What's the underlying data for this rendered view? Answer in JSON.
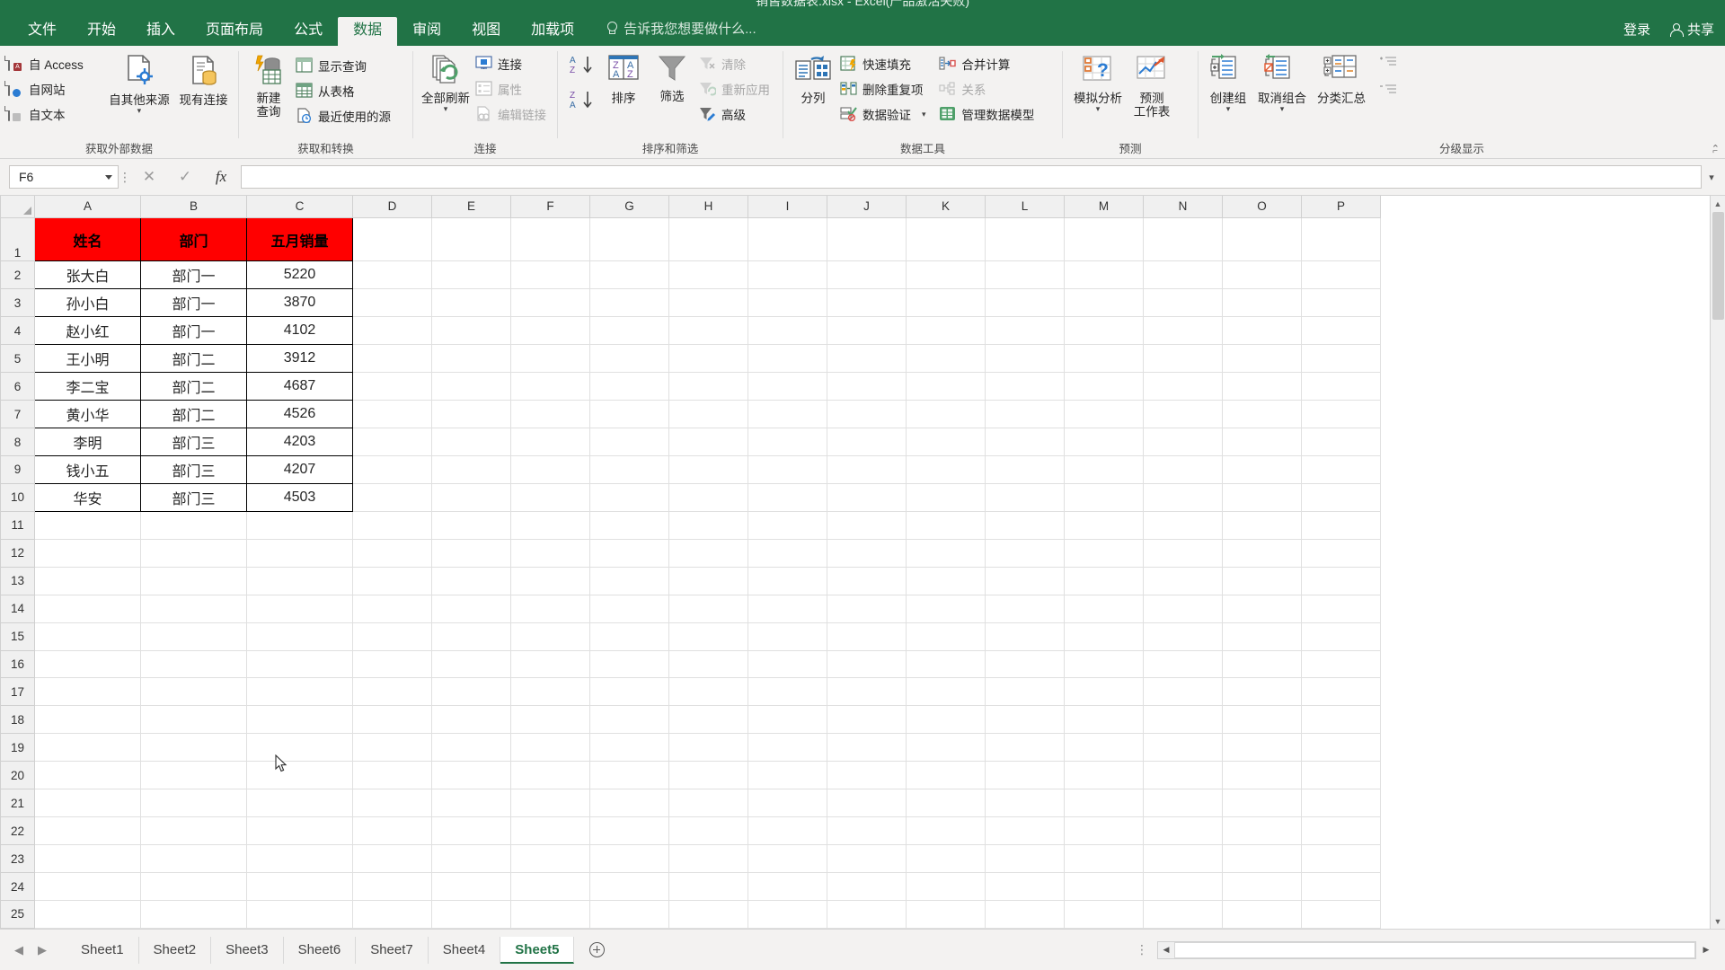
{
  "window": {
    "title": "销售数据表.xlsx - Excel(产品激活失败)"
  },
  "ribbon_tabs": [
    {
      "label": "文件",
      "active": false
    },
    {
      "label": "开始",
      "active": false
    },
    {
      "label": "插入",
      "active": false
    },
    {
      "label": "页面布局",
      "active": false
    },
    {
      "label": "公式",
      "active": false
    },
    {
      "label": "数据",
      "active": true
    },
    {
      "label": "审阅",
      "active": false
    },
    {
      "label": "视图",
      "active": false
    },
    {
      "label": "加载项",
      "active": false
    }
  ],
  "tellme": {
    "placeholder": "告诉我您想要做什么...",
    "icon": "lightbulb-icon"
  },
  "titlebar_right": {
    "signin": "登录",
    "share": "共享",
    "share_icon": "person-icon"
  },
  "ribbon_groups": [
    {
      "name": "获取外部数据",
      "label": "获取外部数据",
      "small_items": [
        "自 Access",
        "自网站",
        "自文本"
      ],
      "big_items": [
        {
          "label_line1": "自其他来源",
          "label_line2": "",
          "has_caret": true,
          "icon": "other-sources-icon"
        },
        {
          "label_line1": "现有连接",
          "label_line2": "",
          "has_caret": false,
          "icon": "existing-connections-icon"
        }
      ]
    },
    {
      "name": "获取和转换",
      "label": "获取和转换",
      "big_items": [
        {
          "label_line1": "新建",
          "label_line2": "查询",
          "has_caret": true,
          "icon": "new-query-icon"
        }
      ],
      "small_items": [
        "显示查询",
        "从表格",
        "最近使用的源"
      ]
    },
    {
      "name": "连接",
      "label": "连接",
      "big_items": [
        {
          "label_line1": "全部刷新",
          "label_line2": "",
          "has_caret": true,
          "icon": "refresh-all-icon"
        }
      ],
      "small_items": [
        {
          "label": "连接",
          "dim": false
        },
        {
          "label": "属性",
          "dim": true
        },
        {
          "label": "编辑链接",
          "dim": true
        }
      ]
    },
    {
      "name": "排序和筛选",
      "label": "排序和筛选",
      "sort_asc": "A→Z",
      "sort_desc": "Z→A",
      "big_items": [
        {
          "label_line1": "排序",
          "label_line2": "",
          "has_caret": false,
          "icon": "sort-icon"
        },
        {
          "label_line1": "筛选",
          "label_line2": "",
          "has_caret": false,
          "icon": "filter-icon"
        }
      ],
      "small_items": [
        {
          "label": "清除",
          "dim": true
        },
        {
          "label": "重新应用",
          "dim": true
        },
        {
          "label": "高级",
          "dim": false
        }
      ]
    },
    {
      "name": "数据工具",
      "label": "数据工具",
      "big_items": [
        {
          "label_line1": "分列",
          "label_line2": "",
          "has_caret": false,
          "icon": "text-to-columns-icon"
        }
      ],
      "small_items_col1": [
        {
          "label": "快速填充",
          "dim": false
        },
        {
          "label": "删除重复项",
          "dim": false
        },
        {
          "label": "数据验证",
          "dim": false,
          "has_caret": true
        }
      ],
      "small_items_col2": [
        {
          "label": "合并计算",
          "dim": false
        },
        {
          "label": "关系",
          "dim": true
        },
        {
          "label": "管理数据模型",
          "dim": false
        }
      ]
    },
    {
      "name": "预测",
      "label": "预测",
      "big_items": [
        {
          "label_line1": "模拟分析",
          "label_line2": "",
          "has_caret": true,
          "icon": "what-if-analysis-icon"
        },
        {
          "label_line1": "预测",
          "label_line2": "工作表",
          "has_caret": false,
          "icon": "forecast-sheet-icon"
        }
      ]
    },
    {
      "name": "分级显示",
      "label": "分级显示",
      "big_items": [
        {
          "label_line1": "创建组",
          "label_line2": "",
          "has_caret": true,
          "icon": "group-icon"
        },
        {
          "label_line1": "取消组合",
          "label_line2": "",
          "has_caret": true,
          "icon": "ungroup-icon"
        },
        {
          "label_line1": "分类汇总",
          "label_line2": "",
          "has_caret": false,
          "icon": "subtotal-icon"
        }
      ],
      "extra_icons": [
        "show-detail-icon",
        "hide-detail-icon"
      ],
      "dialog_launcher": "dialog-launcher-icon"
    }
  ],
  "formula_bar": {
    "name_box_value": "F6",
    "cancel_icon": "cancel-icon",
    "confirm_icon": "confirm-icon",
    "function_icon": "fx-icon",
    "formula_value": "",
    "expand_icon": "chevron-down-icon"
  },
  "grid": {
    "columns": [
      "A",
      "B",
      "C",
      "D",
      "E",
      "F",
      "G",
      "H",
      "I",
      "J",
      "K",
      "L",
      "M",
      "N",
      "O",
      "P"
    ],
    "row_numbers": [
      1,
      2,
      3,
      4,
      5,
      6,
      7,
      8,
      9,
      10,
      11,
      12,
      13,
      14,
      15,
      16,
      17,
      18,
      19,
      20,
      21,
      22,
      23,
      24,
      25
    ],
    "header_row": [
      "姓名",
      "部门",
      "五月销量"
    ],
    "header_fill": "#FF0000",
    "data_rows": [
      [
        "张大白",
        "部门一",
        "5220"
      ],
      [
        "孙小白",
        "部门一",
        "3870"
      ],
      [
        "赵小红",
        "部门一",
        "4102"
      ],
      [
        "王小明",
        "部门二",
        "3912"
      ],
      [
        "李二宝",
        "部门二",
        "4687"
      ],
      [
        "黄小华",
        "部门二",
        "4526"
      ],
      [
        "李明",
        "部门三",
        "4203"
      ],
      [
        "钱小五",
        "部门三",
        "4207"
      ],
      [
        "华安",
        "部门三",
        "4503"
      ]
    ],
    "selected_cell": "F6"
  },
  "sheet_tabs": [
    {
      "label": "Sheet1",
      "active": false
    },
    {
      "label": "Sheet2",
      "active": false
    },
    {
      "label": "Sheet3",
      "active": false
    },
    {
      "label": "Sheet6",
      "active": false
    },
    {
      "label": "Sheet7",
      "active": false
    },
    {
      "label": "Sheet4",
      "active": false
    },
    {
      "label": "Sheet5",
      "active": true
    }
  ],
  "sheet_nav": {
    "prev_icon": "arrow-left-icon",
    "next_icon": "arrow-right-icon",
    "add_sheet_icon": "plus-circle-icon",
    "more_icon": "ellipsis-vertical-icon"
  }
}
